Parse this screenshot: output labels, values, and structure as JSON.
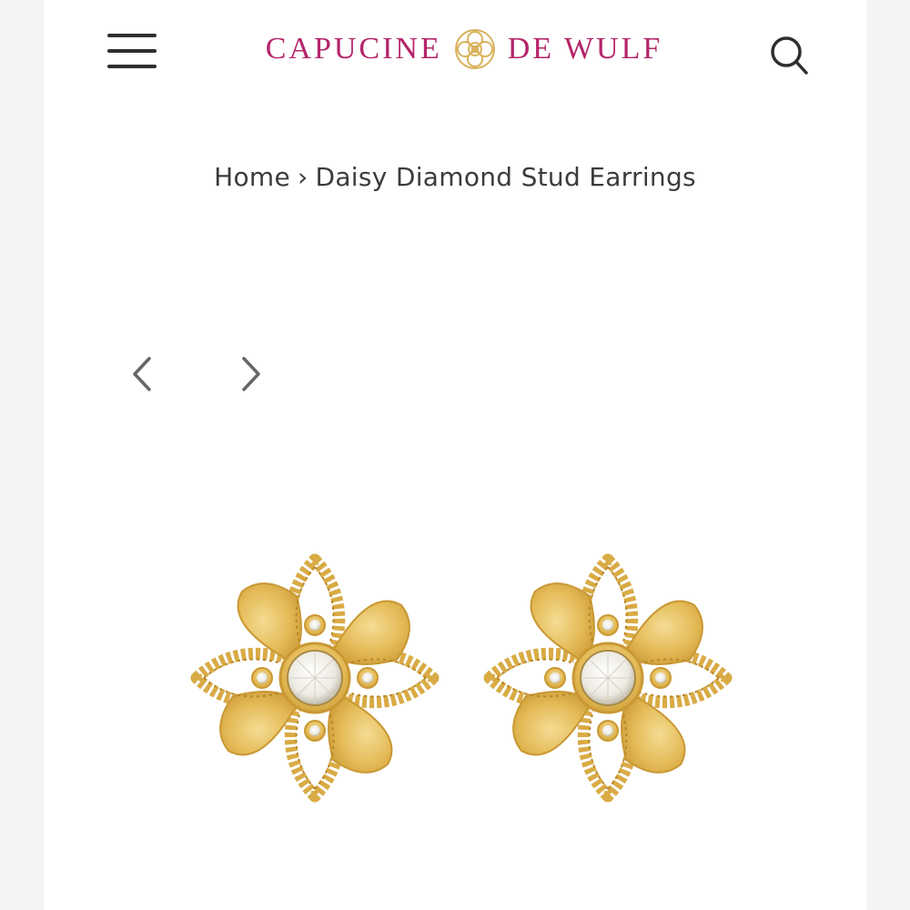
{
  "header": {
    "brand_left": "CAPUCINE",
    "brand_right": "DE WULF",
    "menu_icon": "hamburger-menu-icon",
    "search_icon": "search-icon",
    "brand_color": "#b4246a",
    "emblem_color": "#d8b25c"
  },
  "breadcrumb": {
    "home_label": "Home",
    "separator": "›",
    "current_label": "Daisy Diamond Stud Earrings"
  },
  "gallery": {
    "prev_icon": "chevron-left-icon",
    "next_icon": "chevron-right-icon",
    "image_subject": "gold-flower-diamond-stud-earrings-pair",
    "gold_color": "#e3b955"
  }
}
